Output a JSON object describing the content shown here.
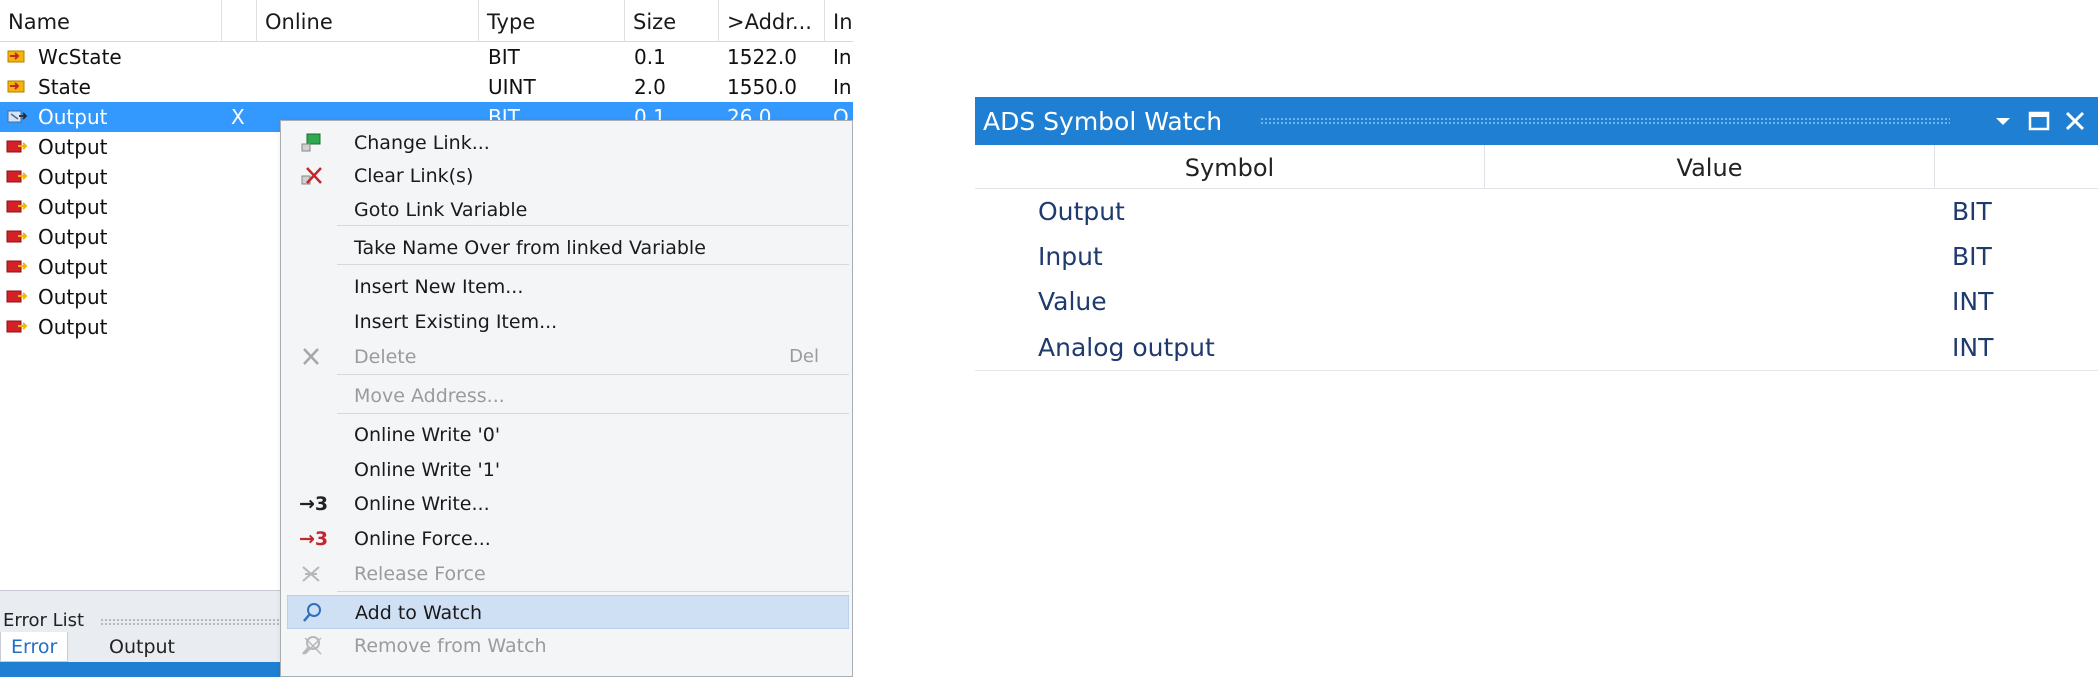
{
  "variables": {
    "columns": [
      "Name",
      "Online",
      "Type",
      "Size",
      ">Addr...",
      "In"
    ],
    "rows": [
      {
        "name": "WcState",
        "online": "",
        "type": "BIT",
        "size": "0.1",
        "addr": "1522.0",
        "in": "In",
        "icon": "input-variable-icon",
        "selected": false
      },
      {
        "name": "State",
        "online": "",
        "type": "UINT",
        "size": "2.0",
        "addr": "1550.0",
        "in": "In",
        "icon": "input-variable-icon",
        "selected": false
      },
      {
        "name": "Output",
        "online": "X",
        "type": "BIT",
        "size": "0.1",
        "addr": "26.0",
        "in": "O",
        "icon": "linked-output-variable-icon",
        "selected": true
      },
      {
        "name": "Output",
        "online": "",
        "type": "",
        "size": "",
        "addr": "",
        "in": "",
        "icon": "output-variable-icon",
        "selected": false
      },
      {
        "name": "Output",
        "online": "",
        "type": "",
        "size": "",
        "addr": "",
        "in": "",
        "icon": "output-variable-icon",
        "selected": false
      },
      {
        "name": "Output",
        "online": "",
        "type": "",
        "size": "",
        "addr": "",
        "in": "",
        "icon": "output-variable-icon",
        "selected": false
      },
      {
        "name": "Output",
        "online": "",
        "type": "",
        "size": "",
        "addr": "",
        "in": "",
        "icon": "output-variable-icon",
        "selected": false
      },
      {
        "name": "Output",
        "online": "",
        "type": "",
        "size": "",
        "addr": "",
        "in": "",
        "icon": "output-variable-icon",
        "selected": false
      },
      {
        "name": "Output",
        "online": "",
        "type": "",
        "size": "",
        "addr": "",
        "in": "",
        "icon": "output-variable-icon",
        "selected": false
      },
      {
        "name": "Output",
        "online": "",
        "type": "",
        "size": "",
        "addr": "",
        "in": "",
        "icon": "output-variable-icon",
        "selected": false
      }
    ]
  },
  "context_menu": {
    "items": [
      {
        "label": "Change Link...",
        "shortcut": "",
        "icon": "change-link-icon",
        "disabled": false,
        "highlighted": false
      },
      {
        "label": "Clear Link(s)",
        "shortcut": "",
        "icon": "clear-link-icon",
        "disabled": false,
        "highlighted": false
      },
      {
        "label": "Goto Link Variable",
        "shortcut": "",
        "icon": "",
        "disabled": false,
        "highlighted": false
      },
      {
        "label": "Take Name Over from linked Variable",
        "shortcut": "",
        "icon": "",
        "disabled": false,
        "highlighted": false
      },
      {
        "label": "Insert New Item...",
        "shortcut": "",
        "icon": "",
        "disabled": false,
        "highlighted": false
      },
      {
        "label": "Insert Existing Item...",
        "shortcut": "",
        "icon": "",
        "disabled": false,
        "highlighted": false
      },
      {
        "label": "Delete",
        "shortcut": "Del",
        "icon": "delete-icon",
        "disabled": true,
        "highlighted": false
      },
      {
        "label": "Move Address...",
        "shortcut": "",
        "icon": "",
        "disabled": true,
        "highlighted": false
      },
      {
        "label": "Online Write '0'",
        "shortcut": "",
        "icon": "",
        "disabled": false,
        "highlighted": false
      },
      {
        "label": "Online Write '1'",
        "shortcut": "",
        "icon": "",
        "disabled": false,
        "highlighted": false
      },
      {
        "label": "Online Write...",
        "shortcut": "",
        "icon": "online-write-icon",
        "icon_text": "→3",
        "disabled": false,
        "highlighted": false
      },
      {
        "label": "Online Force...",
        "shortcut": "",
        "icon": "online-force-icon",
        "icon_text": "→3",
        "disabled": false,
        "highlighted": false
      },
      {
        "label": "Release Force",
        "shortcut": "",
        "icon": "release-force-icon",
        "disabled": true,
        "highlighted": false
      },
      {
        "label": "Add to Watch",
        "shortcut": "",
        "icon": "add-to-watch-icon",
        "disabled": false,
        "highlighted": true
      },
      {
        "label": "Remove from Watch",
        "shortcut": "",
        "icon": "remove-from-watch-icon",
        "disabled": true,
        "highlighted": false
      }
    ]
  },
  "bottom_panel": {
    "title": "Error List",
    "tabs": [
      {
        "label": "Error List",
        "active": true
      },
      {
        "label": "Output",
        "active": false
      }
    ]
  },
  "watch": {
    "title": "ADS Symbol Watch",
    "buttons": [
      "dropdown-icon",
      "maximize-icon",
      "close-icon"
    ],
    "columns": [
      "Symbol",
      "Value",
      ""
    ],
    "rows": [
      {
        "symbol": "Output",
        "value": "",
        "type": "BIT"
      },
      {
        "symbol": "Input",
        "value": "",
        "type": "BIT"
      },
      {
        "symbol": "Value",
        "value": "",
        "type": "INT"
      },
      {
        "symbol": "Analog output",
        "value": "",
        "type": "INT"
      }
    ]
  },
  "colors": {
    "accent": "#1f7fd3",
    "selection": "#3399ff",
    "menu_highlight": "#cfe0f5",
    "watch_text": "#1f3a6e",
    "force_red": "#c0282d"
  }
}
